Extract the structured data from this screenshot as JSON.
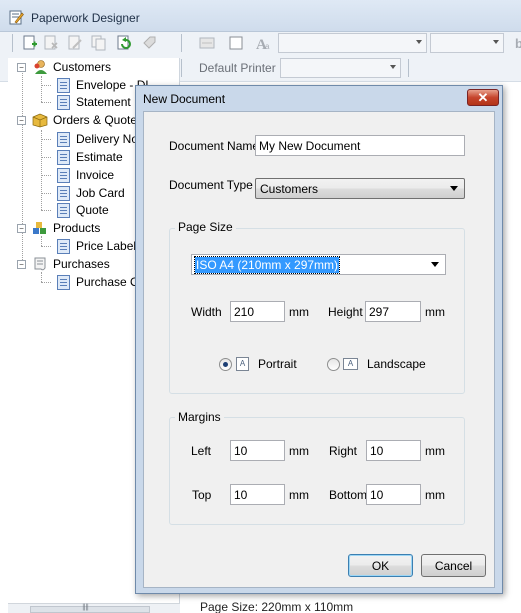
{
  "app": {
    "title": "Paperwork Designer",
    "printer_label": "Default Printer",
    "status_text": "Page Size: 220mm x 110mm",
    "scroll_grip": "∥∥"
  },
  "tree": {
    "groups": [
      {
        "label": "Customers",
        "expander": "−",
        "icon": "customers-icon",
        "children": [
          "Envelope - DL",
          "Statement"
        ]
      },
      {
        "label": "Orders & Quotes",
        "expander": "−",
        "icon": "orders-icon",
        "children": [
          "Delivery Note",
          "Estimate",
          "Invoice",
          "Job Card",
          "Quote"
        ]
      },
      {
        "label": "Products",
        "expander": "−",
        "icon": "products-icon",
        "children": [
          "Price Label"
        ]
      },
      {
        "label": "Purchases",
        "expander": "−",
        "icon": "purchases-icon",
        "children": [
          "Purchase Order"
        ]
      }
    ]
  },
  "dialog": {
    "title": "New Document",
    "close_glyph": "✕",
    "document_name_label": "Document Name",
    "document_name_value": "My New Document",
    "document_type_label": "Document Type",
    "document_type_value": "Customers",
    "page_size_group": "Page Size",
    "page_size_value": "ISO A4 (210mm x 297mm)",
    "width_label": "Width",
    "width_value": "210",
    "width_unit": "mm",
    "height_label": "Height",
    "height_value": "297",
    "height_unit": "mm",
    "portrait_label": "Portrait",
    "landscape_label": "Landscape",
    "orientation_selected": "Portrait",
    "margins_group": "Margins",
    "left_label": "Left",
    "left_value": "10",
    "right_label": "Right",
    "right_value": "10",
    "top_label": "Top",
    "top_value": "10",
    "bottom_label": "Bottom",
    "bottom_value": "10",
    "unit": "mm",
    "ok_label": "OK",
    "cancel_label": "Cancel"
  },
  "colors": {
    "dialog_frame": "#c9d8ea",
    "selection": "#3399ff",
    "close_button": "#c6452c"
  }
}
